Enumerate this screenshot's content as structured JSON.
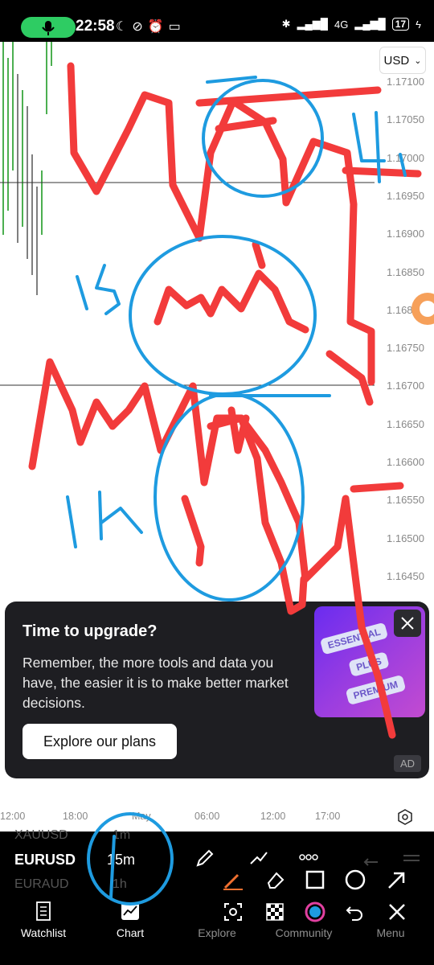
{
  "status_bar": {
    "time": "22:58",
    "network": "4G",
    "battery": "17"
  },
  "chart": {
    "currency": "USD",
    "price_labels": [
      "1.17100",
      "1.17050",
      "1.17000",
      "1.16950",
      "1.16900",
      "1.16850",
      "1.16800",
      "1.16750",
      "1.16700",
      "1.16650",
      "1.16600",
      "1.16550",
      "1.16500",
      "1.16450"
    ],
    "time_labels": [
      "12:00",
      "18:00",
      "May",
      "06:00",
      "12:00",
      "17:00"
    ]
  },
  "annotations": {
    "label_4h": "4h",
    "label_15": "15",
    "label_1h": "1h"
  },
  "ad": {
    "title": "Time to upgrade?",
    "body": "Remember, the more tools and data you have, the easier it is to make better market decisions.",
    "button": "Explore our plans",
    "badge": "AD",
    "tags": [
      "ESSENTIAL",
      "PLUS",
      "PREMIUM"
    ]
  },
  "toolbar": {
    "symbol_above": "XAUUSD",
    "symbol": "EURUSD",
    "symbol_below": "EURAUD",
    "interval_above": "1m",
    "interval": "15m",
    "interval_below": "1h"
  },
  "bottom_nav": {
    "watchlist": "Watchlist",
    "chart": "Chart",
    "explore": "Explore",
    "community": "Community",
    "menu": "Menu"
  },
  "colors": {
    "drawing_red": "#f23b3b",
    "drawing_blue": "#1e9be0",
    "candle_green": "#4caf50",
    "ad_bg": "#1e1e22"
  }
}
